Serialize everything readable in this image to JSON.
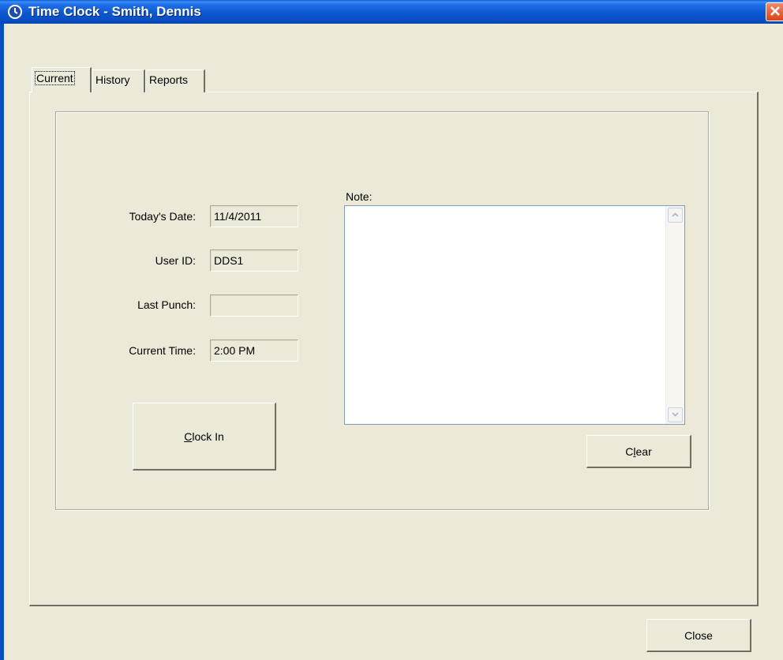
{
  "window": {
    "title": "Time Clock - Smith, Dennis",
    "title_icon": "clock-icon",
    "close_icon": "close-icon"
  },
  "tabs": [
    {
      "label": "Current",
      "active": true
    },
    {
      "label": "History",
      "active": false
    },
    {
      "label": "Reports",
      "active": false
    }
  ],
  "current": {
    "todays_date_label": "Today's Date:",
    "todays_date_value": "11/4/2011",
    "user_id_label": "User ID:",
    "user_id_value": "DDS1",
    "last_punch_label": "Last Punch:",
    "last_punch_value": "",
    "current_time_label": "Current Time:",
    "current_time_value": "2:00 PM",
    "clock_in_mnemonic": "C",
    "clock_in_rest": "lock In",
    "note_label": "Note:",
    "note_value": "",
    "clear_prefix": "C",
    "clear_mnemonic": "l",
    "clear_rest": "ear"
  },
  "footer": {
    "close_label": "Close"
  },
  "colors": {
    "titlebar": "#0a4ec4",
    "face": "#ece9d8",
    "close_button": "#d9441c"
  }
}
